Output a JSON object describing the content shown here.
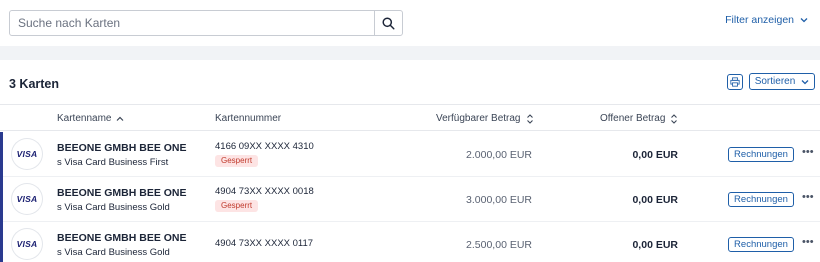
{
  "search": {
    "placeholder": "Suche nach Karten"
  },
  "filter": {
    "label": "Filter anzeigen"
  },
  "list": {
    "count_label": "3 Karten",
    "sort_label": "Sortieren",
    "columns": {
      "name": "Kartenname",
      "number": "Kartennummer",
      "available": "Verfügbarer Betrag",
      "open": "Offener Betrag"
    },
    "rows": [
      {
        "logo": "VISA",
        "name": "BEEONE GMBH BEE ONE",
        "product": "s Visa Card Business First",
        "number": "4166 09XX XXXX 4310",
        "badge": "Gesperrt",
        "available": "2.000,00 EUR",
        "open": "0,00 EUR",
        "action": "Rechnungen"
      },
      {
        "logo": "VISA",
        "name": "BEEONE GMBH BEE ONE",
        "product": "s Visa Card Business Gold",
        "number": "4904 73XX XXXX 0018",
        "badge": "Gesperrt",
        "available": "3.000,00 EUR",
        "open": "0,00 EUR",
        "action": "Rechnungen"
      },
      {
        "logo": "VISA",
        "name": "BEEONE GMBH BEE ONE",
        "product": "s Visa Card Business Gold",
        "number": "4904 73XX XXXX 0117",
        "badge": "",
        "available": "2.500,00 EUR",
        "open": "0,00 EUR",
        "action": "Rechnungen"
      }
    ]
  },
  "colors": {
    "accent": "#1f5fa8",
    "row_marker": "#2a3a8f",
    "blocked_bg": "#fde4e4",
    "blocked_text": "#c0392b"
  },
  "icons": {
    "search": "search-icon",
    "filter": "chevron-down-icon",
    "print": "printer-icon",
    "sort": "chevron-down-icon",
    "column_sort": "sort-updown-icon",
    "more": "more-horizontal-icon"
  }
}
